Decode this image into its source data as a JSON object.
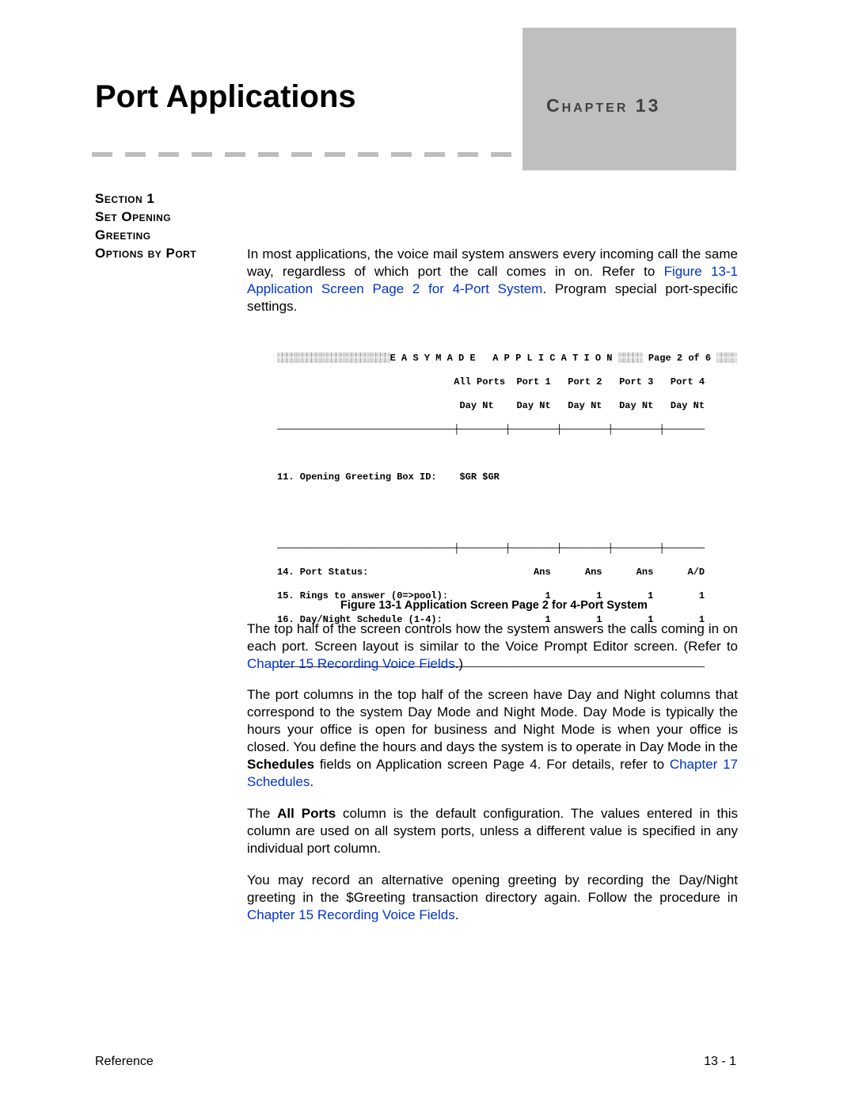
{
  "header": {
    "title": "Port Applications",
    "chapter_label": "Chapter 13"
  },
  "section": {
    "line1": "Section 1",
    "line2": "Set Opening",
    "line3": "Greeting",
    "line4": "Options by Port"
  },
  "para1": {
    "lead": "In most applications, the voice mail system answers every incoming call the same way, regardless of which port the call comes in on. Refer to ",
    "link": "Figure 13-1 Application Screen Page 2 for 4-Port System",
    "tail": ". Program special port-specific settings."
  },
  "figure": {
    "title_left_hatch": "░░░░░░░░░░░░░░░░░░░░░░░",
    "title_text": "E A S Y M A D E   A P P L I C A T I O N ",
    "title_mid_hatch": "░░░░░",
    "title_page": " Page 2 of 6 ",
    "title_right_hatch": "░░░░",
    "hdr1": "                               All Ports  Port 1   Port 2   Port 3   Port 4",
    "hdr2": "                                Day Nt    Day Nt   Day Nt   Day Nt   Day Nt",
    "sep_top": "───────────────────────────────┼────────┼────────┼────────┼────────┼───────",
    "row11": "11. Opening Greeting Box ID:    $GR $GR",
    "sep_mid": "───────────────────────────────┼────────┼────────┼────────┼────────┼───────",
    "row14": "14. Port Status:                             Ans      Ans      Ans      A/D",
    "row15": "15. Rings to answer (0=>pool):                 1        1        1        1",
    "row16": "16. Day/Night Schedule (1-4):                  1        1        1        1",
    "sep_bot": "───────────────────────────────────────────────────────────────────────────",
    "caption": "Figure 13-1   Application Screen Page 2 for 4-Port System"
  },
  "para2": {
    "lead": "The top half of the screen controls how the system answers the calls coming in on each port. Screen layout is similar to the Voice Prompt Editor screen. (Refer to ",
    "link": "Chapter 15 Recording Voice Fields",
    "tail": ".)"
  },
  "para3": {
    "lead": "The port columns in the top half of the screen have Day and Night columns that correspond to the system Day Mode and Night Mode. Day Mode is typically the hours your office is open for business and Night Mode is when your office is closed. You define the hours and days the system is to operate in Day Mode in the ",
    "bold": "Schedules",
    "mid": " fields on Application screen Page 4. For details, refer to ",
    "link": "Chapter 17 Schedules",
    "tail": "."
  },
  "para4": {
    "lead": "The ",
    "bold": "All Ports",
    "tail": " column is the default configuration. The values entered in this column are used on all system ports, unless a different value is specified in any individual port column."
  },
  "para5": {
    "lead": "You may record an alternative opening greeting by recording the Day/Night greeting in the $Greeting transaction directory again. Follow the procedure in ",
    "link": "Chapter 15 Recording Voice Fields",
    "tail": "."
  },
  "footer": {
    "left": "Reference",
    "right": "13 - 1"
  }
}
